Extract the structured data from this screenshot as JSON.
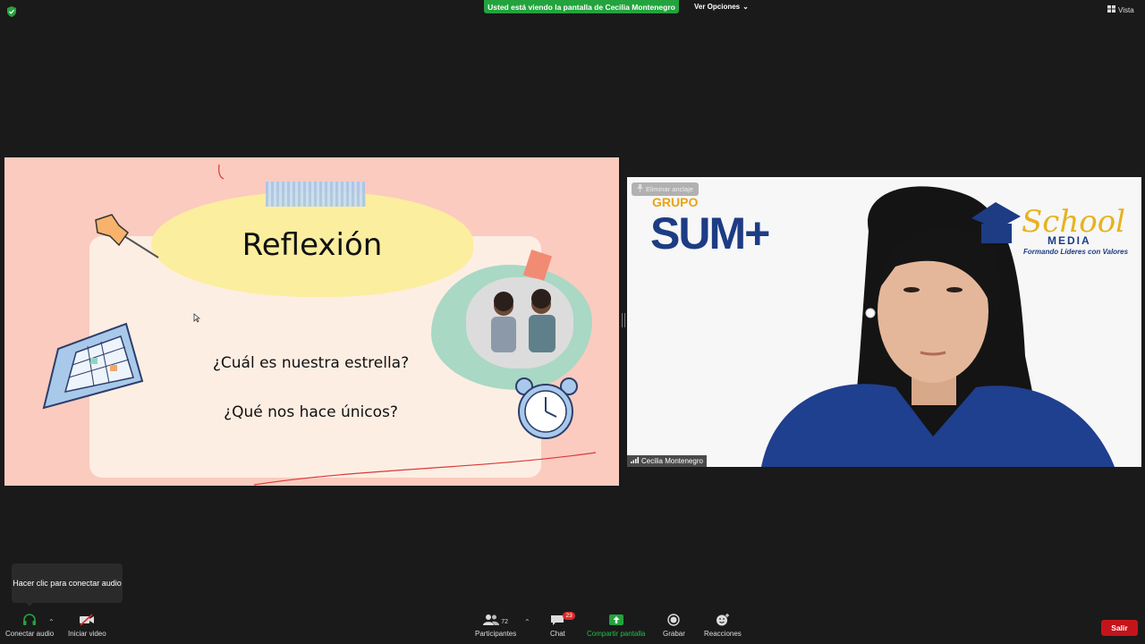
{
  "top_bar": {
    "share_banner": "Usted está viendo la pantalla de Cecilia Montenegro",
    "view_options": "Ver Opciones",
    "view_button": "Vista"
  },
  "slide": {
    "title": "Reflexión",
    "question_1": "¿Cuál es nuestra estrella?",
    "question_2": "¿Qué nos hace únicos?"
  },
  "video": {
    "unpin_label": "Eliminar anclaje",
    "participant_name": "Cecilia Montenegro",
    "logo_grupo": "GRUPO",
    "logo_sum": "SUM+",
    "logo_school": "School",
    "logo_media": "MEDIA",
    "logo_slogan": "Formando Líderes con Valores"
  },
  "tooltip": {
    "text": "Hacer clic para conectar audio"
  },
  "toolbar": {
    "audio_label": "Conectar audio",
    "video_label": "Iniciar video",
    "participants_label": "Participantes",
    "participants_count": "72",
    "chat_label": "Chat",
    "chat_badge": "23",
    "share_label": "Compartir pantalla",
    "record_label": "Grabar",
    "reactions_label": "Reacciones",
    "leave_label": "Salir"
  },
  "colors": {
    "share_green": "#23a33d",
    "leave_red": "#c4141b",
    "slide_pink": "#fbcbbf"
  }
}
